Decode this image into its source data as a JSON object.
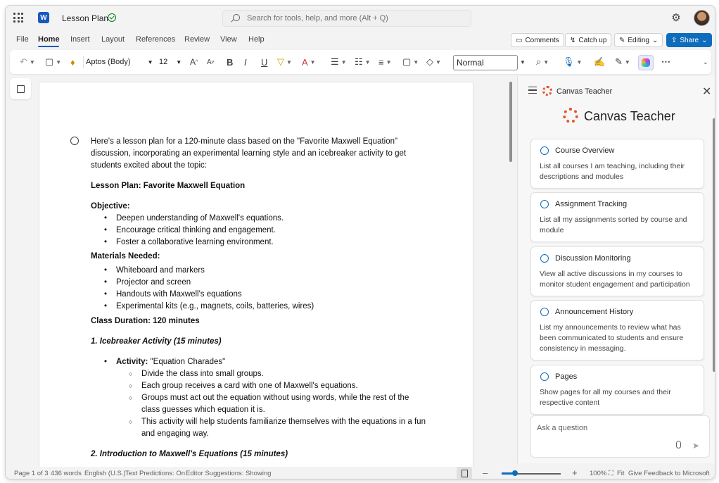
{
  "titlebar": {
    "app_logo": "W",
    "doc_title": "Lesson Plan",
    "search_placeholder": "Search for tools, help, and more (Alt + Q)"
  },
  "menu": {
    "tabs": [
      "File",
      "Home",
      "Insert",
      "Layout",
      "References",
      "Review",
      "View",
      "Help"
    ],
    "active": "Home",
    "comments_label": "Comments",
    "catchup_label": "Catch up",
    "editing_label": "Editing",
    "share_label": "Share"
  },
  "toolbar": {
    "font_name": "Aptos (Body)",
    "font_size": "12",
    "style_name": "Normal"
  },
  "document": {
    "intro": "Here's a lesson plan for a 120-minute class based on the \"Favorite Maxwell Equation\" discussion, incorporating an experimental learning style and an icebreaker activity to get students excited about the topic:",
    "plan_title": "Lesson Plan: Favorite Maxwell Equation",
    "objective_heading": "Objective:",
    "objectives": [
      "Deepen understanding of Maxwell's equations.",
      "Encourage critical thinking and engagement.",
      "Foster a collaborative learning environment."
    ],
    "materials_heading": "Materials Needed:",
    "materials": [
      "Whiteboard and markers",
      "Projector and screen",
      "Handouts with Maxwell's equations",
      "Experimental kits (e.g., magnets, coils, batteries, wires)"
    ],
    "duration": "Class Duration: 120 minutes",
    "section1_heading": "1. Icebreaker Activity (15 minutes)",
    "activity_label": "Activity:",
    "activity_name": " \"Equation Charades\"",
    "activity_steps": [
      "Divide the class into small groups.",
      "Each group receives a card with one of Maxwell's equations.",
      "Groups must act out the equation without using words, while the rest of the class guesses which equation it is.",
      "This activity will help students familiarize themselves with the equations in a fun and engaging way."
    ],
    "section2_heading": "2. Introduction to Maxwell's Equations (15 minutes)"
  },
  "panel": {
    "header_title": "Canvas Teacher",
    "big_title": "Canvas Teacher",
    "cards": [
      {
        "title": "Course Overview",
        "desc": "List all courses I am teaching, including their descriptions and modules"
      },
      {
        "title": "Assignment Tracking",
        "desc": "List all my assignments sorted by course and module"
      },
      {
        "title": "Discussion Monitoring",
        "desc": "View all active discussions in my courses to monitor student engagement and participation"
      },
      {
        "title": "Announcement History",
        "desc": "List my announcements to review what has been communicated to students and ensure consistency in messaging."
      },
      {
        "title": "Pages",
        "desc": "Show pages for all my courses and their respective content"
      }
    ],
    "ask_placeholder": "Ask a question"
  },
  "status": {
    "page": "Page 1 of 3",
    "words": "436 words",
    "language": "English (U.S.)",
    "predictions": "Text Predictions: On",
    "editor": "Editor Suggestions: Showing",
    "zoom_minus": "–",
    "zoom_plus": "+",
    "zoom": "100%",
    "fit": "Fit",
    "feedback": "Give Feedback to Microsoft",
    "zoom_level": 1.0
  },
  "icons": [
    "waffle-icon",
    "word-logo-icon",
    "saved-icon",
    "search-icon",
    "gear-icon",
    "comment-icon",
    "catchup-icon",
    "pencil-icon",
    "share-icon",
    "canvas-logo-icon",
    "close-icon",
    "mic-icon",
    "send-icon"
  ],
  "colors": {
    "accent": "#0f6cbd",
    "word_blue": "#185abd",
    "canvas_orange": "#e4542b"
  }
}
